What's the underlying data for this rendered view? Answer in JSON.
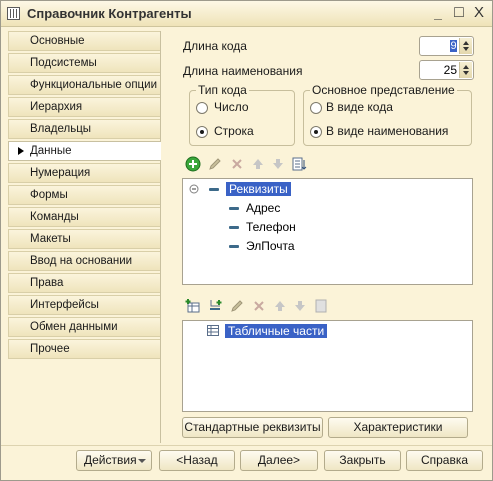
{
  "window": {
    "title": "Справочник Контрагенты",
    "controls": [
      "_",
      "□",
      "X"
    ]
  },
  "tabs": [
    {
      "label": "Основные"
    },
    {
      "label": "Подсистемы"
    },
    {
      "label": "Функциональные опции"
    },
    {
      "label": "Иерархия"
    },
    {
      "label": "Владельцы"
    },
    {
      "label": "Данные",
      "active": true
    },
    {
      "label": "Нумерация"
    },
    {
      "label": "Формы"
    },
    {
      "label": "Команды"
    },
    {
      "label": "Макеты"
    },
    {
      "label": "Ввод на основании"
    },
    {
      "label": "Права"
    },
    {
      "label": "Интерфейсы"
    },
    {
      "label": "Обмен данными"
    },
    {
      "label": "Прочее"
    }
  ],
  "data_tab": {
    "code_length_label": "Длина кода",
    "code_length_value": "9",
    "name_length_label": "Длина наименования",
    "name_length_value": "25",
    "code_type": {
      "title": "Тип кода",
      "options": [
        {
          "label": "Число",
          "checked": false
        },
        {
          "label": "Строка",
          "checked": true
        }
      ]
    },
    "main_presentation": {
      "title": "Основное представление",
      "options": [
        {
          "label": "В виде кода",
          "checked": false
        },
        {
          "label": "В виде наименования",
          "checked": true
        }
      ]
    },
    "attributes_tree": {
      "root": "Реквизиты",
      "children": [
        "Адрес",
        "Телефон",
        "ЭлПочта"
      ]
    },
    "tabular_tree": {
      "root": "Табличные части"
    },
    "standard_attributes_button": "Стандартные реквизиты",
    "characteristics_button": "Характеристики"
  },
  "footer": {
    "actions": "Действия",
    "back": "<Назад",
    "next": "Далее>",
    "close": "Закрыть",
    "help": "Справка"
  }
}
